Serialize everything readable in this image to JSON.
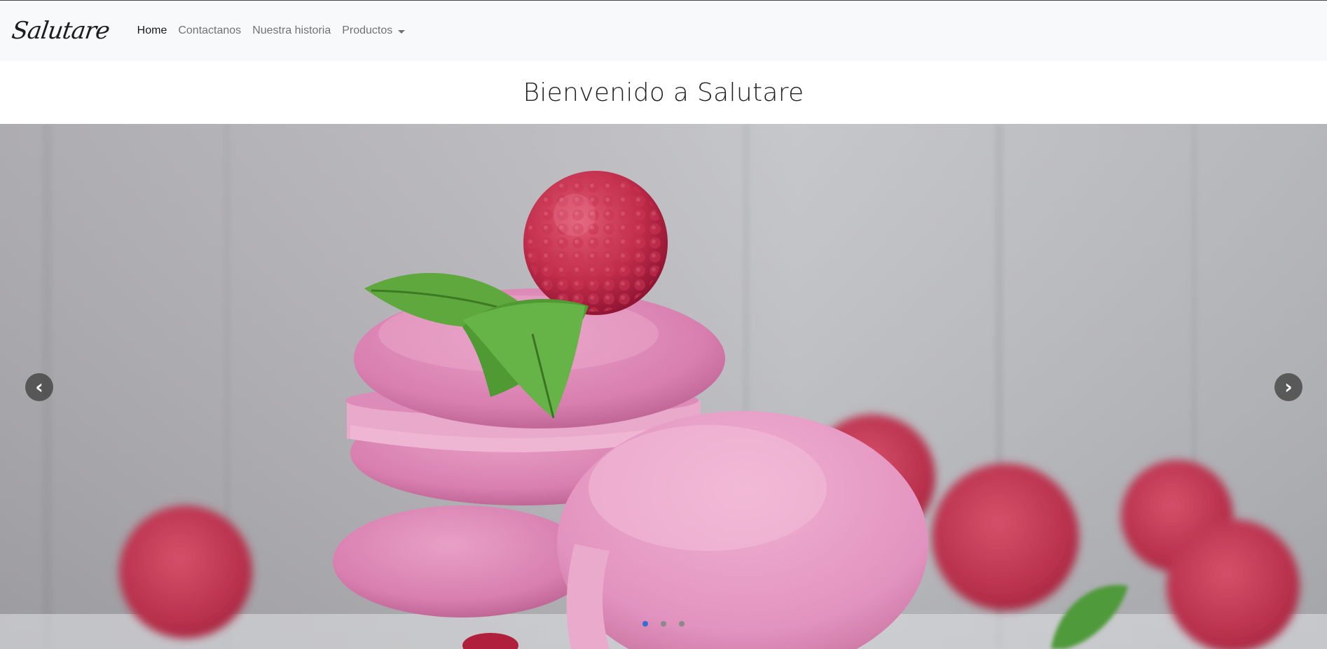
{
  "navbar": {
    "brand": "Salutare",
    "items": [
      {
        "label": "Home",
        "active": true
      },
      {
        "label": "Contactanos",
        "active": false
      },
      {
        "label": "Nuestra historia",
        "active": false
      }
    ],
    "dropdown": {
      "label": "Productos"
    }
  },
  "main": {
    "heading": "Bienvenido a Salutare"
  },
  "carousel": {
    "prev_symbol": "‹",
    "next_symbol": "›",
    "slide_count": 3,
    "active_slide": 1,
    "image_icon": "pink-macarons-raspberries-photo",
    "colors": {
      "indicator_active": "#2f6fd6",
      "indicator_inactive": "#8a8a8a"
    }
  }
}
